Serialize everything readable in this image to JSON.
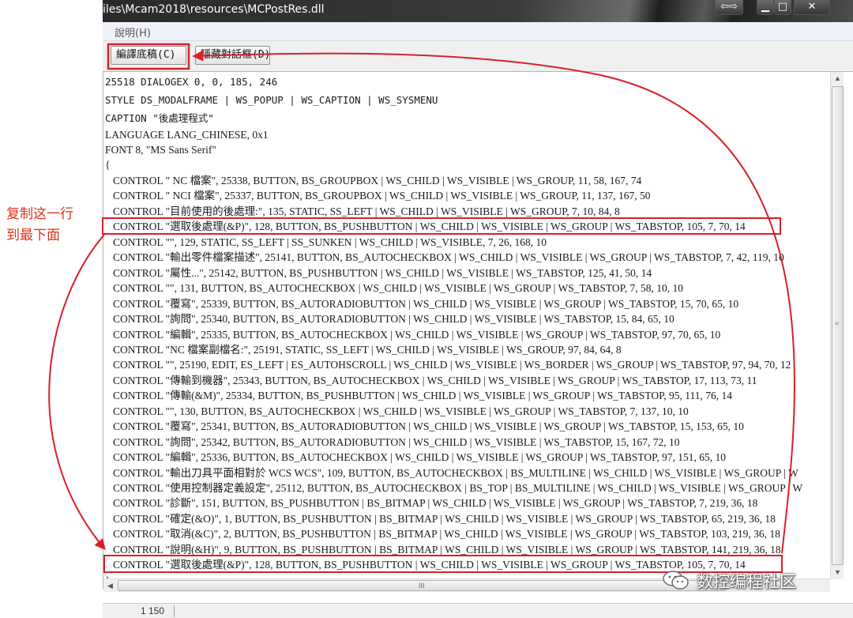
{
  "window": {
    "title": "iles\\Mcam2018\\resources\\MCPostRes.dll",
    "swap_glyph": "⇦⇨",
    "min_glyph": "▁",
    "max_glyph": "□",
    "close_glyph": "✕"
  },
  "menu": {
    "help_label": "說明(H)"
  },
  "toolbar": {
    "compile_label": "編譯底稿(C)",
    "hide_dialog_label": "隱藏對話框(D)"
  },
  "editor": {
    "header_lines": [
      "25518 DIALOGEX 0, 0, 185, 246",
      "STYLE DS_MODALFRAME | WS_POPUP | WS_CAPTION | WS_SYSMENU",
      "CAPTION \"後處理程式\"",
      "LANGUAGE LANG_CHINESE, 0x1",
      "FONT 8, \"MS Sans Serif\"",
      "{"
    ],
    "control_lines": [
      "CONTROL \" NC 檔案\", 25338, BUTTON, BS_GROUPBOX | WS_CHILD | WS_VISIBLE | WS_GROUP, 11, 58, 167, 74",
      "CONTROL \" NCI 檔案\", 25337, BUTTON, BS_GROUPBOX | WS_CHILD | WS_VISIBLE | WS_GROUP, 11, 137, 167, 50",
      "CONTROL \"目前使用的後處理:\", 135, STATIC, SS_LEFT | WS_CHILD | WS_VISIBLE | WS_GROUP, 7, 10, 84, 8",
      "CONTROL \"選取後處理(&P)\", 128, BUTTON, BS_PUSHBUTTON | WS_CHILD | WS_VISIBLE | WS_GROUP | WS_TABSTOP, 105, 7, 70, 14",
      "CONTROL \"\", 129, STATIC, SS_LEFT | SS_SUNKEN | WS_CHILD | WS_VISIBLE, 7, 26, 168, 10",
      "CONTROL \"輸出零件檔案描述\", 25141, BUTTON, BS_AUTOCHECKBOX | WS_CHILD | WS_VISIBLE | WS_GROUP | WS_TABSTOP, 7, 42, 119, 10",
      "CONTROL \"屬性...\", 25142, BUTTON, BS_PUSHBUTTON | WS_CHILD | WS_VISIBLE | WS_TABSTOP, 125, 41, 50, 14",
      "CONTROL \"\", 131, BUTTON, BS_AUTOCHECKBOX | WS_CHILD | WS_VISIBLE | WS_GROUP | WS_TABSTOP, 7, 58, 10, 10",
      "CONTROL \"覆寫\", 25339, BUTTON, BS_AUTORADIOBUTTON | WS_CHILD | WS_VISIBLE | WS_GROUP | WS_TABSTOP, 15, 70, 65, 10",
      "CONTROL \"詢問\", 25340, BUTTON, BS_AUTORADIOBUTTON | WS_CHILD | WS_VISIBLE | WS_TABSTOP, 15, 84, 65, 10",
      "CONTROL \"編輯\", 25335, BUTTON, BS_AUTOCHECKBOX | WS_CHILD | WS_VISIBLE | WS_GROUP | WS_TABSTOP, 97, 70, 65, 10",
      "CONTROL \"NC 檔案副檔名:\", 25191, STATIC, SS_LEFT | WS_CHILD | WS_VISIBLE | WS_GROUP, 97, 84, 64, 8",
      "CONTROL \"\", 25190, EDIT, ES_LEFT | ES_AUTOHSCROLL | WS_CHILD | WS_VISIBLE | WS_BORDER | WS_GROUP | WS_TABSTOP, 97, 94, 70, 12",
      "CONTROL \"傳輸到機器\", 25343, BUTTON, BS_AUTOCHECKBOX | WS_CHILD | WS_VISIBLE | WS_GROUP | WS_TABSTOP, 17, 113, 73, 11",
      "CONTROL \"傳輸(&M)\", 25334, BUTTON, BS_PUSHBUTTON | WS_CHILD | WS_VISIBLE | WS_GROUP | WS_TABSTOP, 95, 111, 76, 14",
      "CONTROL \"\", 130, BUTTON, BS_AUTOCHECKBOX | WS_CHILD | WS_VISIBLE | WS_GROUP | WS_TABSTOP, 7, 137, 10, 10",
      "CONTROL \"覆寫\", 25341, BUTTON, BS_AUTORADIOBUTTON | WS_CHILD | WS_VISIBLE | WS_GROUP | WS_TABSTOP, 15, 153, 65, 10",
      "CONTROL \"詢問\", 25342, BUTTON, BS_AUTORADIOBUTTON | WS_CHILD | WS_VISIBLE | WS_TABSTOP, 15, 167, 72, 10",
      "CONTROL \"編輯\", 25336, BUTTON, BS_AUTOCHECKBOX | WS_CHILD | WS_VISIBLE | WS_GROUP | WS_TABSTOP, 97, 151, 65, 10",
      "CONTROL \"輸出刀具平面相對於 WCS WCS\", 109, BUTTON, BS_AUTOCHECKBOX | BS_MULTILINE | WS_CHILD | WS_VISIBLE | WS_GROUP | W",
      "CONTROL \"使用控制器定義設定\", 25112, BUTTON, BS_AUTOCHECKBOX | BS_TOP | BS_MULTILINE | WS_CHILD | WS_VISIBLE | WS_GROUP | W",
      "CONTROL \"診斷\", 151, BUTTON, BS_PUSHBUTTON | BS_BITMAP | WS_CHILD | WS_VISIBLE | WS_GROUP | WS_TABSTOP, 7, 219, 36, 18",
      "CONTROL \"確定(&O)\", 1, BUTTON, BS_PUSHBUTTON | BS_BITMAP | WS_CHILD | WS_VISIBLE | WS_GROUP | WS_TABSTOP, 65, 219, 36, 18",
      "CONTROL \"取消(&C)\", 2, BUTTON, BS_PUSHBUTTON | BS_BITMAP | WS_CHILD | WS_VISIBLE | WS_GROUP | WS_TABSTOP, 103, 219, 36, 18",
      "CONTROL \"說明(&H)\", 9, BUTTON, BS_PUSHBUTTON | BS_BITMAP | WS_CHILD | WS_VISIBLE | WS_GROUP | WS_TABSTOP, 141, 219, 36, 18",
      "CONTROL \"選取後處理(&P)\", 128, BUTTON, BS_PUSHBUTTON | WS_CHILD | WS_VISIBLE | WS_GROUP | WS_TABSTOP, 105, 7, 70, 14"
    ],
    "closing_line": "}"
  },
  "scrollbars": {
    "up_glyph": "▲",
    "down_glyph": "▼",
    "left_glyph": "◀",
    "grip_h": "III",
    "grip_v": "≡"
  },
  "status": {
    "position": "1 150"
  },
  "annotation": {
    "line1": "复制这一行",
    "line2": "到最下面",
    "color": "#e0321a"
  },
  "watermark": {
    "text": "数控编程社区"
  },
  "colors": {
    "highlight": "#d8202a",
    "arrow": "#d8202a"
  }
}
